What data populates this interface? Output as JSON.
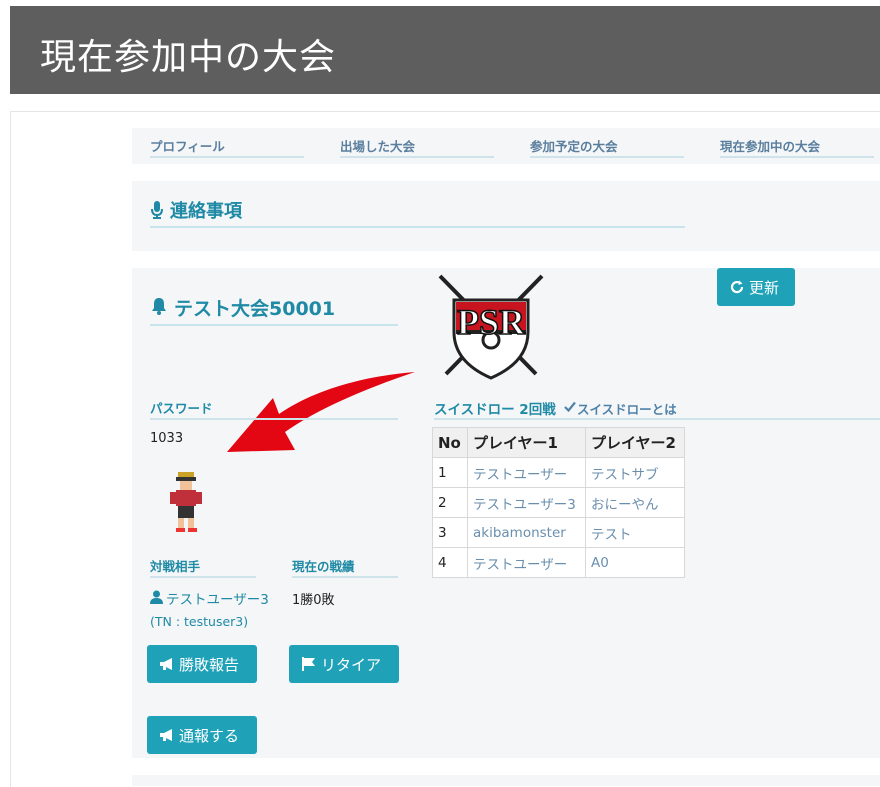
{
  "page_title": "現在参加中の大会",
  "tabs": [
    {
      "label": "プロフィール"
    },
    {
      "label": "出場した大会"
    },
    {
      "label": "参加予定の大会"
    },
    {
      "label": "現在参加中の大会"
    }
  ],
  "notice": {
    "title": "連絡事項",
    "icon": "microphone-icon"
  },
  "tournament": {
    "title": "テスト大会50001",
    "icon": "bell-icon",
    "refresh_label": "更新",
    "logo_text": "PSR",
    "password_label": "パスワード",
    "password_value": "1033",
    "opponent_label": "対戦相手",
    "record_label": "現在の戦績",
    "opponent_name": "テストユーザー3",
    "opponent_tn": "(TN : testuser3)",
    "record_value": "1勝0敗",
    "report_label": "勝敗報告",
    "retire_label": "リタイア",
    "tsuho_label": "通報する"
  },
  "round": {
    "label": "スイスドロー 2回戦",
    "swiss_link": "スイスドローとは",
    "headers": [
      "No",
      "プレイヤー1",
      "プレイヤー2"
    ],
    "rows": [
      {
        "no": "1",
        "p1": "テストユーザー",
        "p2": "テストサブ"
      },
      {
        "no": "2",
        "p1": "テストユーザー3",
        "p2": "おにーやん"
      },
      {
        "no": "3",
        "p1": "akibamonster",
        "p2": "テスト"
      },
      {
        "no": "4",
        "p1": "テストユーザー",
        "p2": "A0"
      }
    ]
  },
  "colors": {
    "accent": "#1fa2b8",
    "title_bar": "#5e5e5e",
    "card": "#f4f6f8",
    "arrow": "#e30613"
  }
}
